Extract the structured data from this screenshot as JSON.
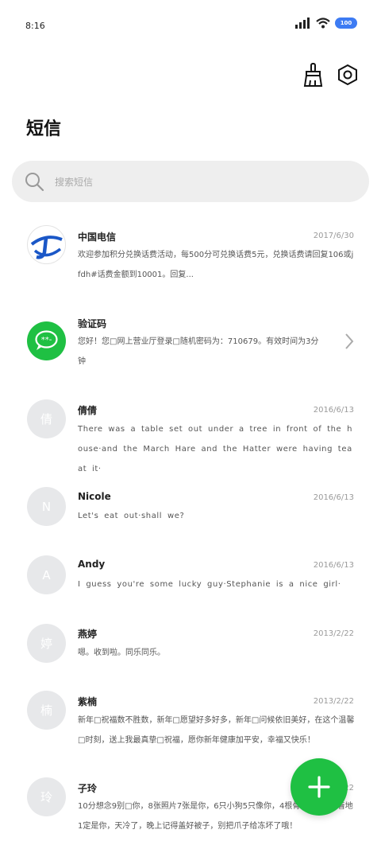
{
  "status_bar": {
    "time": "8:16",
    "battery": "100"
  },
  "toolbar": {
    "clean_icon": "broom-icon",
    "settings_icon": "gear-icon"
  },
  "page_title": "短信",
  "search": {
    "placeholder": "搜索短信"
  },
  "messages": [
    {
      "sender": "中国电信",
      "date": "2017/6/30",
      "avatar": "china-telecom-logo",
      "preview": "欢迎参加积分兑换话费活动，每500分可兑换话费5元，兑换话费请回复106或jfdh#话费金额到10001。回复..."
    },
    {
      "sender": "验证码",
      "date": "",
      "avatar": "verification-code-icon",
      "preview": "您好！您□网上营业厅登录□随机密码为：710679。有效时间为3分钟"
    },
    {
      "sender": "倩倩",
      "date": "2016/6/13",
      "avatar": "倩",
      "preview": "There was a table set out under a tree in front of the house·and the March Hare and the Hatter were having tea at it·"
    },
    {
      "sender": "Nicole",
      "date": "2016/6/13",
      "avatar": "N",
      "preview": "Let's eat out·shall we?"
    },
    {
      "sender": "Andy",
      "date": "2016/6/13",
      "avatar": "A",
      "preview": "I guess you're some lucky guy·Stephanie is a nice girl·"
    },
    {
      "sender": "燕婷",
      "date": "2013/2/22",
      "avatar": "婷",
      "preview": "嗯。收到啦。同乐同乐。"
    },
    {
      "sender": "紫楠",
      "date": "2013/2/22",
      "avatar": "楠",
      "preview": "新年□祝福数不胜数，新年□愿望好多好多，新年□问候依旧美好，在这个温馨□时刻，送上我最真挚□祝福，愿你新年健康加平安，幸福又快乐！"
    },
    {
      "sender": "子玲",
      "date": "2013/2/22",
      "avatar": "玲",
      "preview": "10分想念9别□你，8张照片7张是你，6只小狗5只像你，4根骨头你，2爪着地1定是你，天冷了，晚上记得盖好被子，别把爪子给冻坏了哦！"
    }
  ],
  "fab": {
    "icon": "plus-icon"
  },
  "colors": {
    "accent_green": "#1fc043",
    "battery_blue": "#3d7bf3",
    "search_bg": "#eeeeee"
  }
}
